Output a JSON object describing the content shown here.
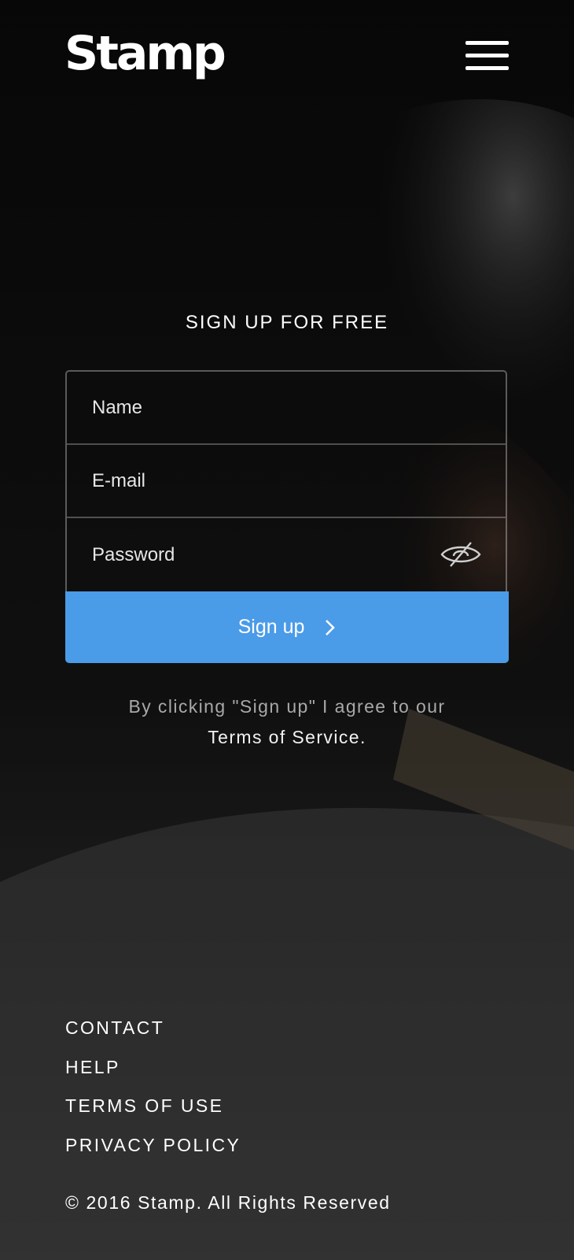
{
  "header": {
    "logo_text": "Stamp",
    "menu_icon": "hamburger-menu-icon"
  },
  "form": {
    "title": "SIGN UP FOR FREE",
    "name_placeholder": "Name",
    "email_placeholder": "E-mail",
    "password_placeholder": "Password",
    "password_toggle_icon": "eye-slash-icon",
    "submit_label": "Sign up",
    "submit_icon": "chevron-right-icon",
    "agreement_text": "By clicking \"Sign up\" I agree to our",
    "terms_link": "Terms of Service",
    "terms_suffix": "."
  },
  "footer": {
    "links": [
      "CONTACT",
      "HELP",
      "TERMS OF USE",
      "PRIVACY POLICY"
    ],
    "copyright": "© 2016 Stamp. All Rights Reserved"
  },
  "colors": {
    "accent": "#4a9be8",
    "background": "#101010",
    "text": "#ffffff",
    "muted_text": "#a9a9a9"
  }
}
